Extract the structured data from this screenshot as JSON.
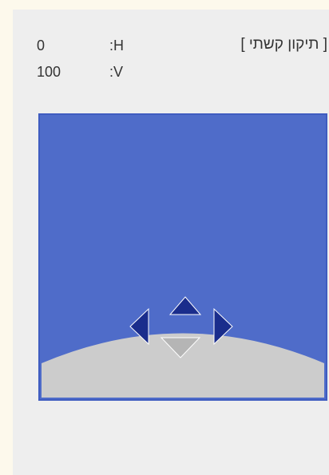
{
  "keystone": {
    "title": "[ תיקון קשתי ]",
    "h_label": ":H",
    "h_value": "0",
    "v_label": ":V",
    "v_value": "100"
  },
  "colors": {
    "screen_blue": "#4f6cc9",
    "screen_border": "#3f5cc0",
    "curve_gray": "#cccccc",
    "arrow_active": "#1a2d8c",
    "arrow_inactive": "#b5b5b5"
  },
  "icons": {
    "up": "triangle-up-icon",
    "down": "triangle-down-icon",
    "left": "triangle-left-icon",
    "right": "triangle-right-icon"
  }
}
